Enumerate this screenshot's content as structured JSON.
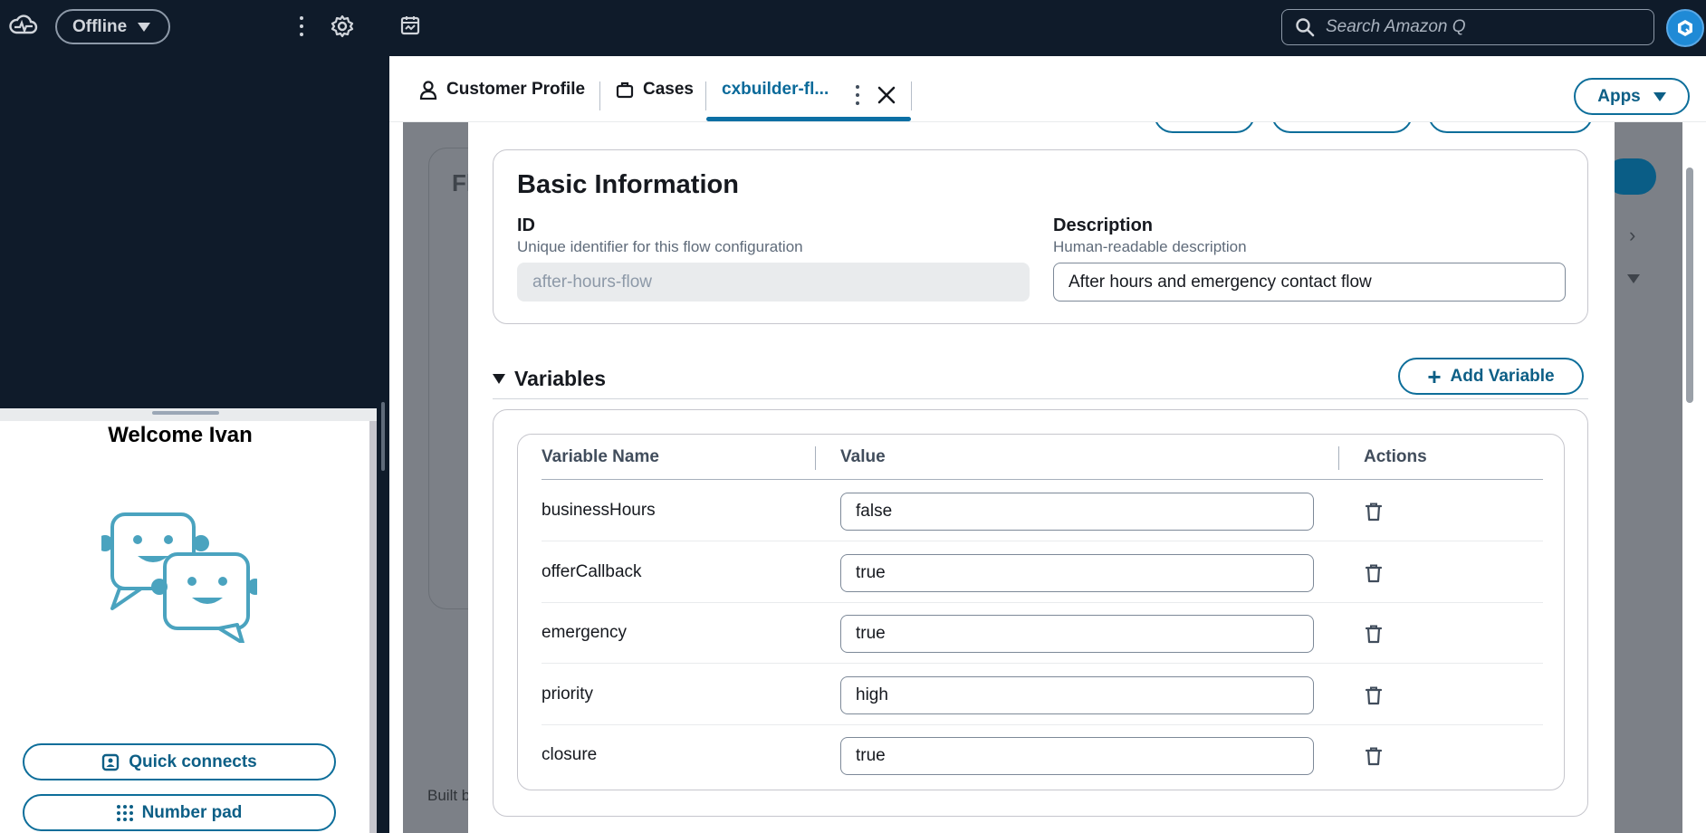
{
  "ccp": {
    "status": "Offline",
    "welcome": "Welcome Ivan",
    "quick_connects": "Quick connects",
    "number_pad": "Number pad"
  },
  "topbar": {
    "search_placeholder": "Search Amazon Q"
  },
  "tabs": [
    {
      "label": "Customer Profile",
      "icon": "user-icon"
    },
    {
      "label": "Cases",
      "icon": "briefcase-icon"
    },
    {
      "label": "cxbuilder-fl...",
      "icon": null,
      "active": true
    }
  ],
  "apps_label": "Apps",
  "background": {
    "title": "Fl",
    "built_by": "Built b"
  },
  "basic_info": {
    "title": "Basic Information",
    "id_label": "ID",
    "id_help": "Unique identifier for this flow configuration",
    "id_value": "after-hours-flow",
    "desc_label": "Description",
    "desc_help": "Human-readable description",
    "desc_value": "After hours and emergency contact flow"
  },
  "variables": {
    "title": "Variables",
    "add_label": "Add Variable",
    "columns": [
      "Variable Name",
      "Value",
      "Actions"
    ],
    "rows": [
      {
        "name": "businessHours",
        "value": "false"
      },
      {
        "name": "offerCallback",
        "value": "true"
      },
      {
        "name": "emergency",
        "value": "true"
      },
      {
        "name": "priority",
        "value": "high"
      },
      {
        "name": "closure",
        "value": "true"
      }
    ]
  },
  "colors": {
    "nav_bg": "#0f1b2a",
    "accent": "#0d6e9a",
    "overlay": "#7c8087"
  }
}
